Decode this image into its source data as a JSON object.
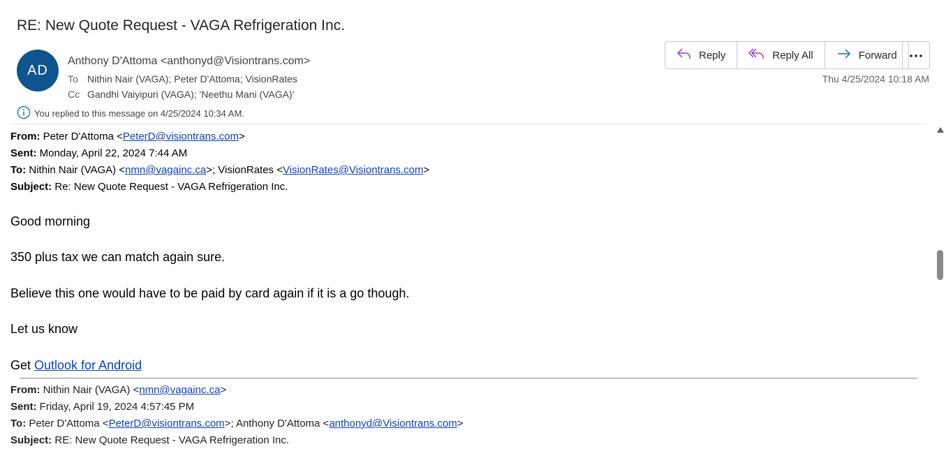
{
  "email": {
    "subject": "RE: New Quote Request - VAGA Refrigeration Inc.",
    "avatar_initials": "AD",
    "avatar_color": "#0f548c",
    "sender": "Anthony D'Attoma <anthonyd@Visiontrans.com>",
    "to_label": "To",
    "to": "Nithin Nair (VAGA); Peter D'Attoma; VisionRates",
    "cc_label": "Cc",
    "cc": "Gandhi Vaiyipuri (VAGA); 'Neethu Mani (VAGA)'",
    "info_text": "You replied to this message on 4/25/2024 10:34 AM.",
    "date": "Thu 4/25/2024 10:18 AM"
  },
  "actions": {
    "reply": "Reply",
    "reply_all": "Reply All",
    "forward": "Forward"
  },
  "icons": {
    "reply": "reply-icon",
    "reply_all": "reply-all-icon",
    "forward": "forward-icon",
    "more": "more-icon",
    "info": "info-icon"
  },
  "message1": {
    "from_label": "From:",
    "from_name": " Peter D'Attoma <",
    "from_email": "PeterD@visiontrans.com",
    "from_close": ">",
    "sent_label": "Sent:",
    "sent": " Monday, April 22, 2024 7:44 AM",
    "to_label": "To:",
    "to_name1": " Nithin Nair (VAGA) <",
    "to_email1": "nmn@vagainc.ca",
    "to_mid": ">; VisionRates <",
    "to_email2": "VisionRates@Visiontrans.com",
    "to_close": ">",
    "subject_label": "Subject:",
    "subject": " Re: New Quote Request - VAGA Refrigeration Inc.",
    "greeting": "Good morning",
    "line1": "350 plus tax we can match again sure.",
    "line2": "Believe this one would have to be paid by card again if it is a go though.",
    "line3": "Let us know",
    "get_prefix": "Get ",
    "get_link": "Outlook for Android"
  },
  "message2": {
    "from_label": "From:",
    "from_name": " Nithin Nair (VAGA) <",
    "from_email": "nmn@vagainc.ca",
    "from_close": ">",
    "sent_label": "Sent:",
    "sent": " Friday, April 19, 2024 4:57:45 PM",
    "to_label": "To:",
    "to_name1": " Peter D'Attoma <",
    "to_email1": "PeterD@visiontrans.com",
    "to_mid": ">; Anthony D'Attoma <",
    "to_email2": "anthonyd@Visiontrans.com",
    "to_close": ">",
    "subject_label": "Subject:",
    "subject": " RE: New Quote Request - VAGA Refrigeration Inc."
  }
}
